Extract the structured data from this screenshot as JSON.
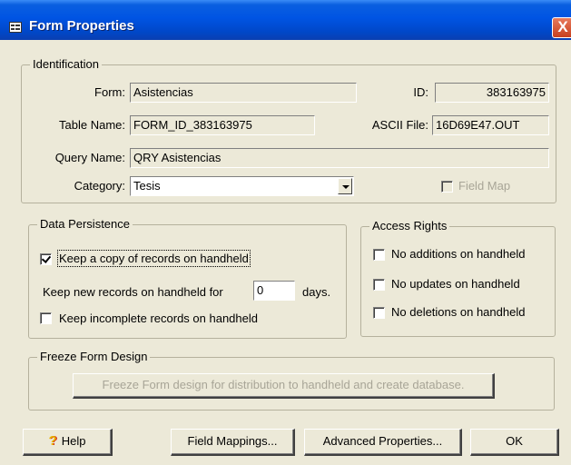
{
  "window": {
    "title": "Form Properties",
    "close_label": "X"
  },
  "identification": {
    "legend": "Identification",
    "form_label": "Form:",
    "form_value": "Asistencias",
    "id_label": "ID:",
    "id_value": "383163975",
    "table_label": "Table Name:",
    "table_value": "FORM_ID_383163975",
    "ascii_label": "ASCII File:",
    "ascii_value": "16D69E47.OUT",
    "query_label": "Query Name:",
    "query_value": "QRY Asistencias",
    "category_label": "Category:",
    "category_value": "Tesis",
    "field_map_label": "Field Map"
  },
  "data_persistence": {
    "legend": "Data Persistence",
    "keep_copy_label": "Keep a copy of records on handheld",
    "keep_copy_checked": true,
    "keep_new_label": "Keep new records on handheld for",
    "keep_new_days": "0",
    "days_label": "days.",
    "keep_incomplete_label": "Keep incomplete records on handheld",
    "keep_incomplete_checked": false
  },
  "access_rights": {
    "legend": "Access Rights",
    "no_additions": "No additions on handheld",
    "no_updates": "No updates on handheld",
    "no_deletions": "No deletions on handheld"
  },
  "freeze": {
    "legend": "Freeze Form Design",
    "button_label": "Freeze Form design for distribution to handheld and create database."
  },
  "buttons": {
    "help": "Help",
    "help_icon": "?",
    "field_mappings": "Field Mappings...",
    "advanced": "Advanced Properties...",
    "ok": "OK"
  }
}
